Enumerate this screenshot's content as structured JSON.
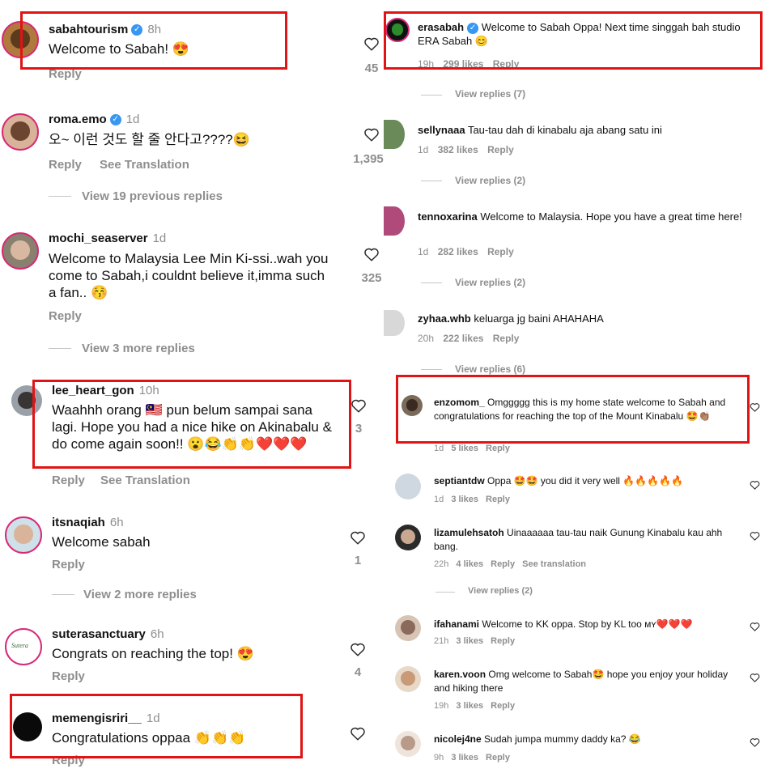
{
  "left_comments": [
    {
      "username": "sabahtourism",
      "verified": true,
      "time": "8h",
      "text": "Welcome to Sabah! 😍",
      "actions": [
        "Reply"
      ],
      "likes": "45"
    },
    {
      "username": "roma.emo",
      "verified": true,
      "time": "1d",
      "text": "오~ 이런 것도 할 줄 안다고????😆",
      "actions": [
        "Reply",
        "See Translation"
      ],
      "likes": "1,395",
      "view_replies": "View 19 previous replies"
    },
    {
      "username": "mochi_seaserver",
      "verified": false,
      "time": "1d",
      "text": "Welcome to Malaysia Lee Min Ki-ssi..wah you come to Sabah,i couldnt believe it,imma such a fan.. 😚",
      "actions": [
        "Reply"
      ],
      "likes": "325",
      "view_replies": "View 3 more replies"
    },
    {
      "username": "lee_heart_gon",
      "verified": false,
      "time": "10h",
      "text": "Waahhh orang 🇲🇾 pun belum sampai sana lagi. Hope you had a nice hike on Akinabalu & do come again soon!! 😮😂👏👏❤️❤️❤️",
      "actions": [
        "Reply",
        "See Translation"
      ],
      "likes": "3"
    },
    {
      "username": "itsnaqiah",
      "verified": false,
      "time": "6h",
      "text": "Welcome sabah",
      "actions": [
        "Reply"
      ],
      "likes": "1",
      "view_replies": "View 2 more replies"
    },
    {
      "username": "suterasanctuary",
      "verified": false,
      "time": "6h",
      "text": "Congrats on reaching the top! 😍",
      "actions": [
        "Reply"
      ],
      "likes": "4",
      "avatar_text": "Sutera"
    },
    {
      "username": "memengisriri__",
      "verified": false,
      "time": "1d",
      "text": "Congratulations oppaa 👏👏👏",
      "actions": [
        "Reply"
      ],
      "likes": ""
    }
  ],
  "right_comments": [
    {
      "username": "erasabah",
      "verified": true,
      "text": "Welcome to Sabah Oppa! Next time singgah bah studio ERA Sabah 😊",
      "time": "19h",
      "likes": "299 likes",
      "actions": [
        "Reply"
      ],
      "view_replies": "View replies (7)"
    },
    {
      "username": "sellynaaa",
      "text": "Tau-tau dah di kinabalu aja abang satu ini",
      "time": "1d",
      "likes": "382 likes",
      "actions": [
        "Reply"
      ],
      "view_replies": "View replies (2)"
    },
    {
      "username": "tennoxarina",
      "text": "Welcome to Malaysia. Hope you have a great time here!",
      "time": "1d",
      "likes": "282 likes",
      "actions": [
        "Reply"
      ],
      "view_replies": "View replies (2)"
    },
    {
      "username": "zyhaa.whb",
      "text": "keluarga jg baini AHAHAHA",
      "time": "20h",
      "likes": "222 likes",
      "actions": [
        "Reply"
      ],
      "view_replies": "View replies (6)"
    },
    {
      "username": "enzomom_",
      "text": "Omggggg this is my home state welcome to Sabah and congratulations for reaching the top of the Mount Kinabalu 🤩👏🏽",
      "time": "1d",
      "likes": "5 likes",
      "actions": [
        "Reply"
      ]
    },
    {
      "username": "septiantdw",
      "text": "Oppa 🤩🤩 you did it very well 🔥🔥🔥🔥🔥",
      "time": "1d",
      "likes": "3 likes",
      "actions": [
        "Reply"
      ]
    },
    {
      "username": "lizamulehsatoh",
      "text": "Uinaaaaaa tau-tau naik Gunung Kinabalu kau ahh bang.",
      "time": "22h",
      "likes": "4 likes",
      "actions": [
        "Reply",
        "See translation"
      ],
      "view_replies": "View replies (2)"
    },
    {
      "username": "ifahanami",
      "text": "Welcome to KK oppa. Stop by KL too ᴍʏ❤️❤️❤️",
      "time": "21h",
      "likes": "3 likes",
      "actions": [
        "Reply"
      ]
    },
    {
      "username": "karen.voon",
      "text": "Omg welcome to Sabah🤩 hope you enjoy your holiday and hiking there",
      "time": "19h",
      "likes": "3 likes",
      "actions": [
        "Reply"
      ]
    },
    {
      "username": "nicolej4ne",
      "text": "Sudah jumpa mummy daddy ka? 😂",
      "time": "9h",
      "likes": "3 likes",
      "actions": [
        "Reply"
      ]
    }
  ],
  "icons": {
    "heart": "heart-outline-icon",
    "verified": "verified-badge-icon"
  },
  "colors": {
    "highlight_box": "#e01414",
    "muted": "#8e8e8e",
    "verified": "#3897f0",
    "story_ring": "#d62976"
  }
}
